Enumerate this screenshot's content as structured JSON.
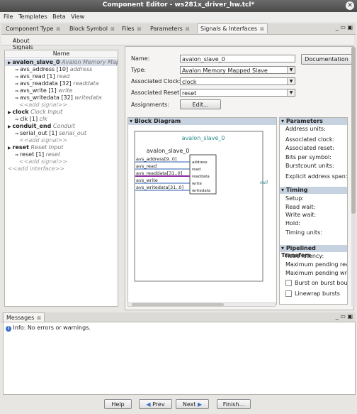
{
  "window": {
    "title": "Component Editor - ws281x_driver_hw.tcl*"
  },
  "menu": [
    "File",
    "Templates",
    "Beta",
    "View"
  ],
  "tabs": [
    {
      "label": "Component Type",
      "closable": true
    },
    {
      "label": "Block Symbol",
      "closable": true
    },
    {
      "label": "Files",
      "closable": true
    },
    {
      "label": "Parameters",
      "closable": true
    },
    {
      "label": "Signals & Interfaces",
      "closable": true,
      "active": true
    }
  ],
  "about": {
    "label": "About Signals"
  },
  "tree": {
    "header": "Name",
    "rows": [
      {
        "name": "avalon_slave_0",
        "type": "Avalon Memory Mapp",
        "level": 0,
        "bold": true,
        "selected": true
      },
      {
        "name": "avs_address [10]",
        "type": "address",
        "level": 1
      },
      {
        "name": "avs_read [1]",
        "type": "read",
        "level": 1
      },
      {
        "name": "avs_readdata [32]",
        "type": "readdata",
        "level": 1
      },
      {
        "name": "avs_write [1]",
        "type": "write",
        "level": 1
      },
      {
        "name": "avs_writedata [32]",
        "type": "writedata",
        "level": 1
      },
      {
        "name": "<<add signal>>",
        "type": "",
        "level": 2,
        "add": true
      },
      {
        "name": "clock",
        "type": "Clock Input",
        "level": 0,
        "bold": true
      },
      {
        "name": "clk [1]",
        "type": "clk",
        "level": 1
      },
      {
        "name": "conduit_end",
        "type": "Conduit",
        "level": 0,
        "bold": true
      },
      {
        "name": "serial_out [1]",
        "type": "serial_out",
        "level": 1
      },
      {
        "name": "<<add signal>>",
        "type": "",
        "level": 2,
        "add": true
      },
      {
        "name": "reset",
        "type": "Reset Input",
        "level": 0,
        "bold": true
      },
      {
        "name": "reset [1]",
        "type": "reset",
        "level": 1
      },
      {
        "name": "<<add signal>>",
        "type": "",
        "level": 2,
        "add": true
      },
      {
        "name": "<<add interface>>",
        "type": "",
        "level": 0,
        "add": true
      }
    ]
  },
  "form": {
    "name_label": "Name:",
    "name_value": "avalon_slave_0",
    "type_label": "Type:",
    "type_value": "Avalon Memory Mapped Slave",
    "clock_label": "Associated Clock:",
    "clock_value": "clock",
    "reset_label": "Associated Reset:",
    "reset_value": "reset",
    "assign_label": "Assignments:",
    "edit_button": "Edit...",
    "doc_button": "Documentation"
  },
  "block": {
    "header": "Block Diagram",
    "top_name": "avalon_slave_0",
    "inner_name": "avalon_slave_0",
    "signals": [
      "avs_address[9..0]",
      "avs_read",
      "avs_readdata[31..0]",
      "avs_write",
      "avs_writedata[31..0]"
    ],
    "ports": [
      "address",
      "read",
      "readdata",
      "write",
      "writedata"
    ],
    "null_label": "null"
  },
  "params": {
    "parameters_header": "Parameters",
    "parameters": [
      "Address units:",
      "Associated clock:",
      "Associated reset:",
      "Bits per symbol:",
      "Burstcount units:",
      "Explicit address span:"
    ],
    "timing_header": "Timing",
    "timing": [
      "Setup:",
      "Read wait:",
      "Write wait:",
      "Hold:",
      "Timing units:"
    ],
    "pipelined_header": "Pipelined Transfers",
    "pipelined": [
      "Read latency:",
      "Maximum pending read",
      "Maximum pending write"
    ],
    "checkboxes": [
      "Burst on burst boun",
      "Linewrap bursts"
    ]
  },
  "messages": {
    "tab": "Messages",
    "text": "Info: No errors or warnings."
  },
  "footer": {
    "help": "Help",
    "prev": "Prev",
    "next": "Next",
    "finish": "Finish..."
  }
}
